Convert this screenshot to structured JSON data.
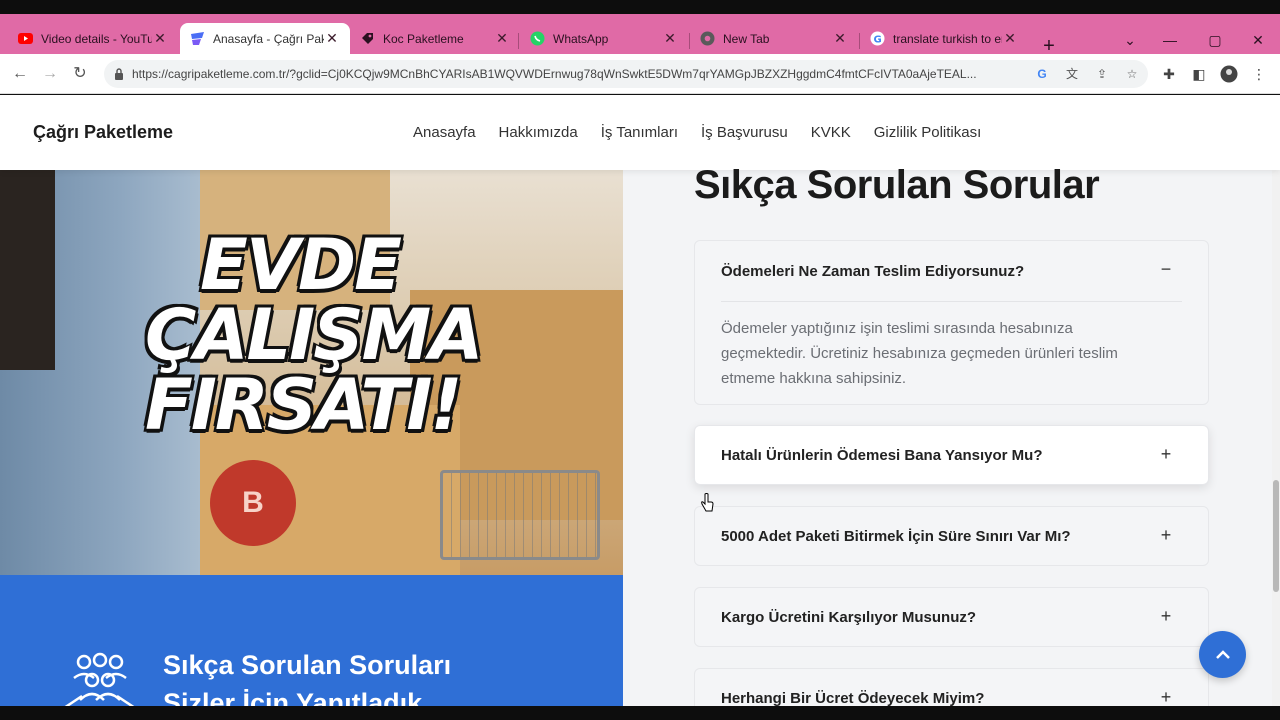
{
  "browser": {
    "tabs": [
      {
        "title": "Video details - YouTube",
        "icon": "youtube-icon",
        "active": false
      },
      {
        "title": "Anasayfa - Çağrı Paketleme",
        "icon": "site-icon",
        "active": true
      },
      {
        "title": "Koc Paketleme",
        "icon": "site-icon",
        "active": false
      },
      {
        "title": "WhatsApp",
        "icon": "whatsapp-icon",
        "active": false
      },
      {
        "title": "New Tab",
        "icon": "chrome-icon",
        "active": false
      },
      {
        "title": "translate turkish to english",
        "icon": "google-icon",
        "active": false
      }
    ],
    "url": "https://cagripaketleme.com.tr/?gclid=Cj0KCQjw9MCnBhCYARIsAB1WQVWDErnwug78qWnSwktE5DWm7qrYAMGpJBZXZHggdmC4fmtCFcIVTA0aAjeTEAL...",
    "tab_strip_color": "#e06aa6"
  },
  "site": {
    "brand": "Çağrı Paketleme",
    "menu": [
      "Anasayfa",
      "Hakkımızda",
      "İş Tanımları",
      "İş Başvurusu",
      "KVKK",
      "Gizlilik Politikası"
    ],
    "hero_lines": [
      "EVDE",
      "ÇALIŞMA",
      "FIRSATI!"
    ],
    "hero_logo_letter": "B",
    "blue_panel": {
      "line1": "Sıkça Sorulan Soruları",
      "line2": "Sizler İçin Yanıtladık",
      "color": "#2f6fd6"
    },
    "faq": {
      "title": "Sıkça Sorulan Sorular",
      "items": [
        {
          "question": "Ödemeleri Ne Zaman Teslim Ediyorsunuz?",
          "toggle": "−",
          "expanded": true,
          "answer": "Ödemeler yaptığınız işin teslimi sırasında hesabınıza geçmektedir. Ücretiniz hesabınıza geçmeden ürünleri teslim etmeme hakkına sahipsiniz."
        },
        {
          "question": "Hatalı Ürünlerin Ödemesi Bana Yansıyor Mu?",
          "toggle": "+",
          "expanded": false
        },
        {
          "question": "5000 Adet Paketi Bitirmek İçin Süre Sınırı Var Mı?",
          "toggle": "+",
          "expanded": false
        },
        {
          "question": "Kargo Ücretini Karşılıyor Musunuz?",
          "toggle": "+",
          "expanded": false
        },
        {
          "question": "Herhangi Bir Ücret Ödeyecek Miyim?",
          "toggle": "+",
          "expanded": false
        }
      ]
    },
    "scroll_top_icon": "chevron-up-icon"
  }
}
